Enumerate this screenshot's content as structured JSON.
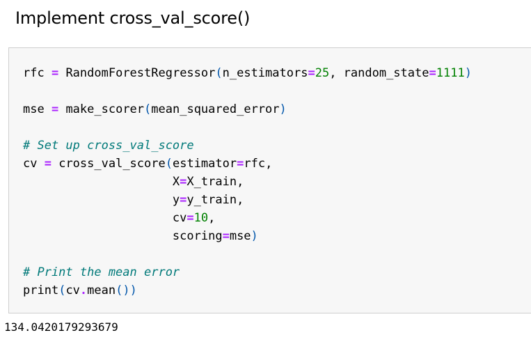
{
  "heading": "Implement cross_val_score()",
  "code_lines": [
    [
      [
        "plain",
        "rfc "
      ],
      [
        "op",
        "="
      ],
      [
        "plain",
        " RandomForestRegressor"
      ],
      [
        "paren",
        "("
      ],
      [
        "plain",
        "n_estimators"
      ],
      [
        "op",
        "="
      ],
      [
        "num",
        "25"
      ],
      [
        "plain",
        ", random_state"
      ],
      [
        "op",
        "="
      ],
      [
        "num",
        "1111"
      ],
      [
        "paren",
        ")"
      ]
    ],
    [],
    [
      [
        "plain",
        "mse "
      ],
      [
        "op",
        "="
      ],
      [
        "plain",
        " make_scorer"
      ],
      [
        "paren",
        "("
      ],
      [
        "plain",
        "mean_squared_error"
      ],
      [
        "paren",
        ")"
      ]
    ],
    [],
    [
      [
        "comment",
        "# Set up cross_val_score"
      ]
    ],
    [
      [
        "plain",
        "cv "
      ],
      [
        "op",
        "="
      ],
      [
        "plain",
        " cross_val_score"
      ],
      [
        "paren",
        "("
      ],
      [
        "plain",
        "estimator"
      ],
      [
        "op",
        "="
      ],
      [
        "plain",
        "rfc,"
      ]
    ],
    [
      [
        "plain",
        "                     X"
      ],
      [
        "op",
        "="
      ],
      [
        "plain",
        "X_train,"
      ]
    ],
    [
      [
        "plain",
        "                     y"
      ],
      [
        "op",
        "="
      ],
      [
        "plain",
        "y_train,"
      ]
    ],
    [
      [
        "plain",
        "                     cv"
      ],
      [
        "op",
        "="
      ],
      [
        "num",
        "10"
      ],
      [
        "plain",
        ","
      ]
    ],
    [
      [
        "plain",
        "                     scoring"
      ],
      [
        "op",
        "="
      ],
      [
        "plain",
        "mse"
      ],
      [
        "paren",
        ")"
      ]
    ],
    [],
    [
      [
        "comment",
        "# Print the mean error"
      ]
    ],
    [
      [
        "plain",
        "print"
      ],
      [
        "paren",
        "("
      ],
      [
        "plain",
        "cv"
      ],
      [
        "op",
        "."
      ],
      [
        "plain",
        "mean"
      ],
      [
        "paren",
        "())"
      ]
    ]
  ],
  "output": "134.0420179293679",
  "colors": {
    "operator": "#aa22ff",
    "number": "#008000",
    "comment": "#007979",
    "paren": "#0055aa",
    "cell_background": "#f7f7f7",
    "cell_border": "#cfcfcf"
  }
}
